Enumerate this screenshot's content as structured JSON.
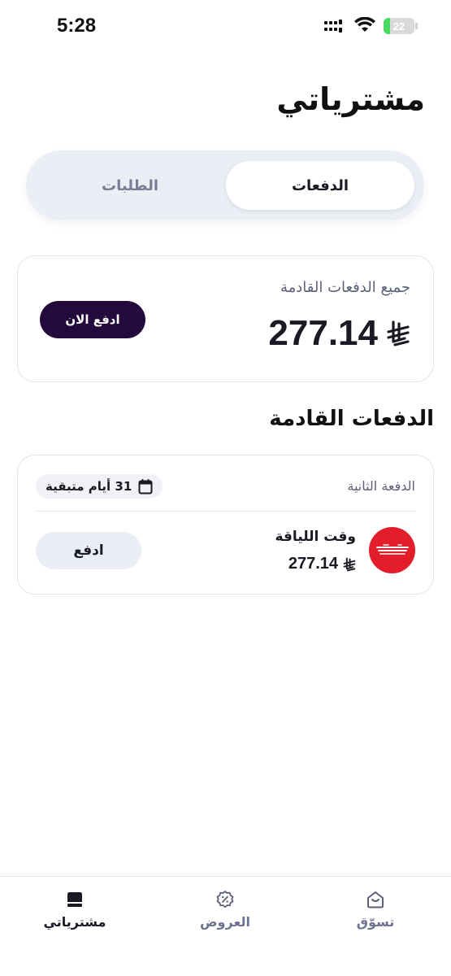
{
  "status_bar": {
    "time": "5:28",
    "battery_level": "22",
    "battery_percent": 22,
    "battery_color": "#4cd964"
  },
  "page": {
    "title": "مشترياتي"
  },
  "tabs": {
    "active_label": "الدفعات",
    "inactive_label": "الطلبات"
  },
  "summary": {
    "label": "جميع الدفعات القادمة",
    "amount": "277.14",
    "currency_icon": "riyal-icon",
    "pay_now_label": "ادفع الان"
  },
  "upcoming": {
    "section_title": "الدفعات القادمة",
    "installment": {
      "label": "الدفعة الثانية",
      "days_remaining": "31 أيام متبقية",
      "merchant_name": "وقت اللياقة",
      "merchant_logo": "fitness-time-logo",
      "amount": "277.14",
      "pay_label": "ادفع"
    }
  },
  "bottom_nav": {
    "items": [
      {
        "label": "تسوّق",
        "icon": "shop-icon",
        "active": false
      },
      {
        "label": "العروض",
        "icon": "discount-icon",
        "active": false
      },
      {
        "label": "مشترياتي",
        "icon": "purchases-icon",
        "active": true
      }
    ]
  },
  "colors": {
    "primary_dark": "#240a3c",
    "merchant_red": "#e31d2a",
    "segment_bg": "#eceef6",
    "muted_text": "#6f7290"
  }
}
